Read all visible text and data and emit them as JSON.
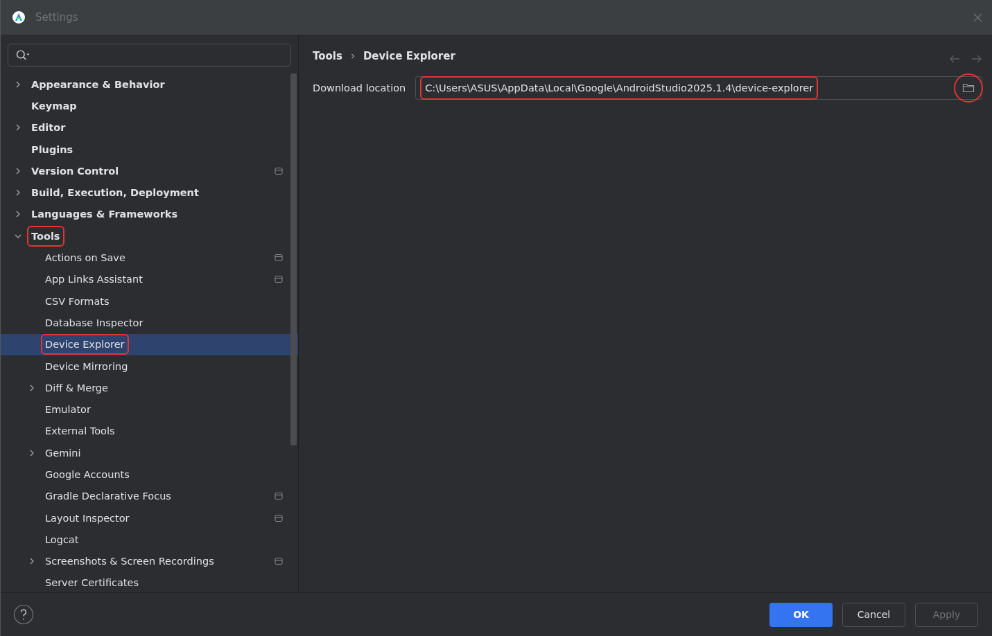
{
  "window": {
    "title": "Settings"
  },
  "tree": [
    {
      "label": "Appearance & Behavior",
      "kind": "folder",
      "expanded": false,
      "selected": false,
      "highlighted": false,
      "project_scope": false
    },
    {
      "label": "Keymap",
      "kind": "page",
      "selected": false,
      "highlighted": false,
      "project_scope": false
    },
    {
      "label": "Editor",
      "kind": "folder",
      "expanded": false,
      "selected": false,
      "highlighted": false,
      "project_scope": false
    },
    {
      "label": "Plugins",
      "kind": "page",
      "selected": false,
      "highlighted": false,
      "project_scope": false
    },
    {
      "label": "Version Control",
      "kind": "folder",
      "expanded": false,
      "selected": false,
      "highlighted": false,
      "project_scope": true
    },
    {
      "label": "Build, Execution, Deployment",
      "kind": "folder",
      "expanded": false,
      "selected": false,
      "highlighted": false,
      "project_scope": false
    },
    {
      "label": "Languages & Frameworks",
      "kind": "folder",
      "expanded": false,
      "selected": false,
      "highlighted": false,
      "project_scope": false
    },
    {
      "label": "Tools",
      "kind": "folder",
      "expanded": true,
      "selected": false,
      "highlighted": true,
      "project_scope": false,
      "children": [
        {
          "label": "Actions on Save",
          "kind": "page",
          "selected": false,
          "highlighted": false,
          "project_scope": true
        },
        {
          "label": "App Links Assistant",
          "kind": "page",
          "selected": false,
          "highlighted": false,
          "project_scope": true
        },
        {
          "label": "CSV Formats",
          "kind": "page",
          "selected": false,
          "highlighted": false,
          "project_scope": false
        },
        {
          "label": "Database Inspector",
          "kind": "page",
          "selected": false,
          "highlighted": false,
          "project_scope": false
        },
        {
          "label": "Device Explorer",
          "kind": "page",
          "selected": true,
          "highlighted": true,
          "project_scope": false
        },
        {
          "label": "Device Mirroring",
          "kind": "page",
          "selected": false,
          "highlighted": false,
          "project_scope": false
        },
        {
          "label": "Diff & Merge",
          "kind": "folder",
          "expanded": false,
          "selected": false,
          "highlighted": false,
          "project_scope": false
        },
        {
          "label": "Emulator",
          "kind": "page",
          "selected": false,
          "highlighted": false,
          "project_scope": false
        },
        {
          "label": "External Tools",
          "kind": "page",
          "selected": false,
          "highlighted": false,
          "project_scope": false
        },
        {
          "label": "Gemini",
          "kind": "folder",
          "expanded": false,
          "selected": false,
          "highlighted": false,
          "project_scope": false
        },
        {
          "label": "Google Accounts",
          "kind": "page",
          "selected": false,
          "highlighted": false,
          "project_scope": false
        },
        {
          "label": "Gradle Declarative Focus",
          "kind": "page",
          "selected": false,
          "highlighted": false,
          "project_scope": true
        },
        {
          "label": "Layout Inspector",
          "kind": "page",
          "selected": false,
          "highlighted": false,
          "project_scope": true
        },
        {
          "label": "Logcat",
          "kind": "page",
          "selected": false,
          "highlighted": false,
          "project_scope": false
        },
        {
          "label": "Screenshots & Screen Recordings",
          "kind": "folder",
          "expanded": false,
          "selected": false,
          "highlighted": false,
          "project_scope": true
        },
        {
          "label": "Server Certificates",
          "kind": "page",
          "selected": false,
          "highlighted": false,
          "project_scope": false
        }
      ]
    }
  ],
  "breadcrumb": [
    "Tools",
    "Device Explorer"
  ],
  "nav": {
    "back_disabled": true,
    "forward_disabled": true
  },
  "fields": [
    {
      "label": "Download location",
      "value": "C:\\Users\\ASUS\\AppData\\Local\\Google\\AndroidStudio2025.1.4\\device-explorer",
      "highlighted": true,
      "browse_circled": true
    }
  ],
  "buttons": [
    {
      "label": "OK",
      "kind": "primary",
      "disabled": false
    },
    {
      "label": "Cancel",
      "kind": "secondary",
      "disabled": false
    },
    {
      "label": "Apply",
      "kind": "secondary",
      "disabled": true
    }
  ]
}
